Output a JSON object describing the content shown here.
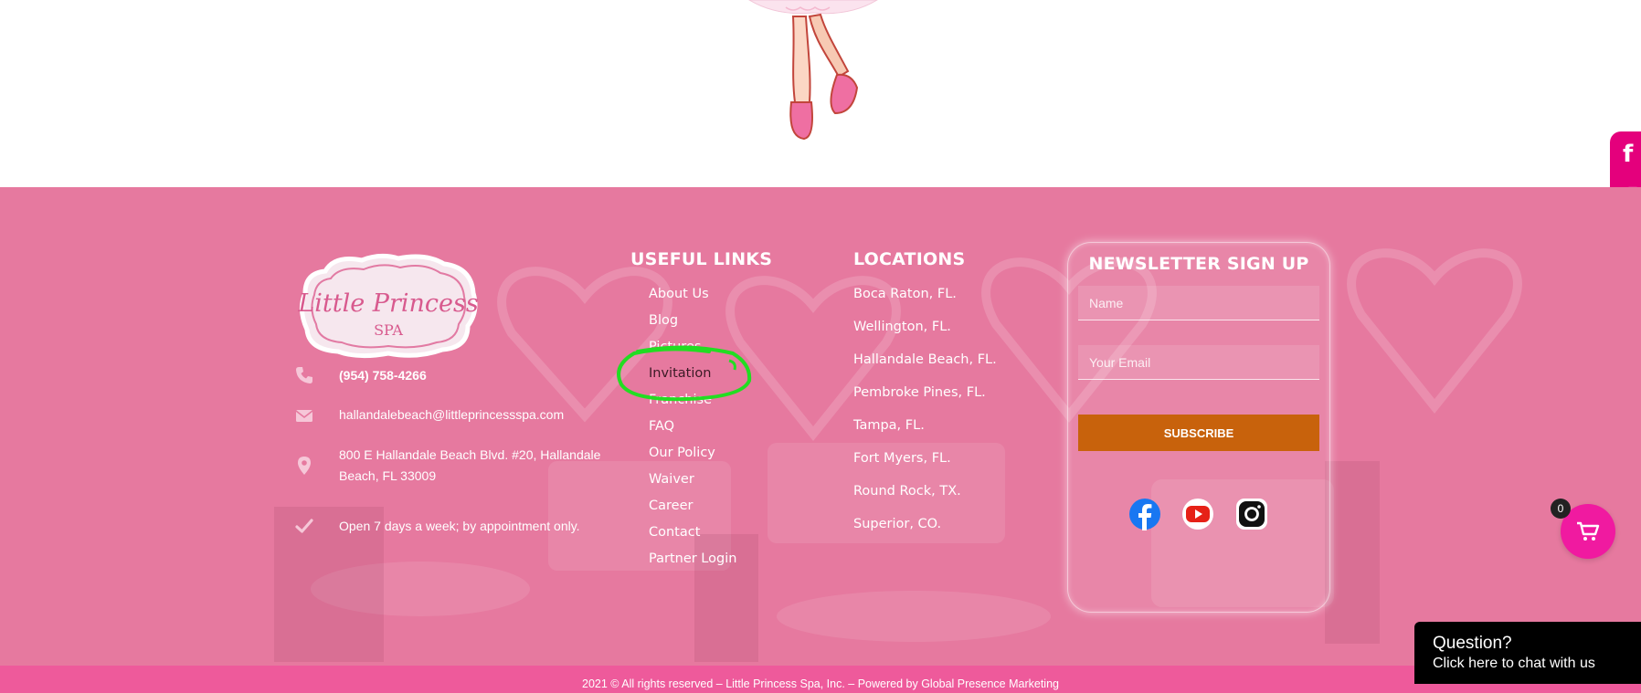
{
  "side_social": {
    "icons": [
      "facebook-icon",
      "instagram-icon"
    ],
    "color": "#e4007c"
  },
  "footer": {
    "logo_text": "Little Princess SPA",
    "contact": {
      "phone": "(954) 758-4266",
      "email": "hallandalebeach@littleprincessspa.com",
      "address_line1": "800 E Hallandale Beach Blvd. #20, Hallandale",
      "address_line2": "Beach, FL 33009",
      "hours": "Open 7 days a week; by appointment only."
    },
    "useful_links": {
      "title": "USEFUL LINKS",
      "items": [
        "About Us",
        "Blog",
        "Pictures",
        "Invitation",
        "Franchise",
        "FAQ",
        "Our Policy",
        "Waiver",
        "Career",
        "Contact",
        "Partner Login"
      ]
    },
    "locations": {
      "title": "LOCATIONS",
      "items": [
        "Boca Raton, FL.",
        "Wellington, FL.",
        "Hallandale Beach, FL.",
        "Pembroke Pines, FL.",
        "Tampa, FL.",
        "Fort Myers, FL.",
        "Round Rock, TX.",
        "Superior, CO."
      ]
    },
    "newsletter": {
      "title": "NEWSLETTER SIGN UP",
      "name_placeholder": "Name",
      "email_placeholder": "Your Email",
      "subscribe_label": "SUBSCRIBE",
      "social": [
        "facebook-icon",
        "youtube-icon",
        "instagram-icon"
      ]
    },
    "copyright": "2021 © All rights reserved – Little Princess Spa, Inc. – Powered by Global Presence Marketing",
    "colors": {
      "footer_bg": "#e6799f",
      "bottom_bar": "#ee5a9b",
      "subscribe": "#c8620c",
      "annotation": "#22dd22"
    }
  },
  "cart": {
    "count": "0"
  },
  "chat": {
    "title": "Question?",
    "subtitle": "Click here to chat with us"
  }
}
